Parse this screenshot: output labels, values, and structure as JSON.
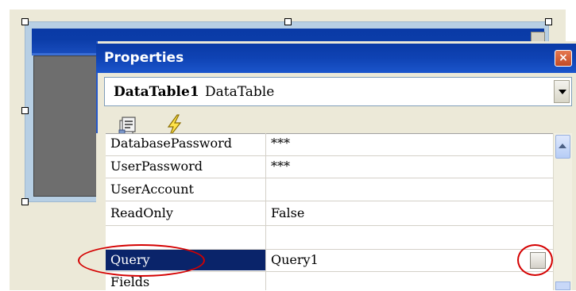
{
  "properties_window": {
    "title": "Properties",
    "close_label": "×",
    "selected_object": {
      "name": "DataTable1",
      "type": "DataTable"
    },
    "toolbar": {
      "buttons": [
        {
          "icon": "properties-icon"
        },
        {
          "icon": "events-lightning-icon"
        }
      ]
    },
    "properties": [
      {
        "name": "DatabasePassword",
        "value": "***"
      },
      {
        "name": "UserPassword",
        "value": "***"
      },
      {
        "name": "UserAccount",
        "value": ""
      },
      {
        "name": "ReadOnly",
        "value": "False"
      },
      {
        "name": "Query",
        "value": "Query1",
        "selected": true
      },
      {
        "name": "Fields",
        "value": ""
      }
    ],
    "colors": {
      "title_bar": "#0a3aa6",
      "selection": "#0a246a",
      "close_button": "#c24b26",
      "annotation": "#d40000"
    }
  }
}
